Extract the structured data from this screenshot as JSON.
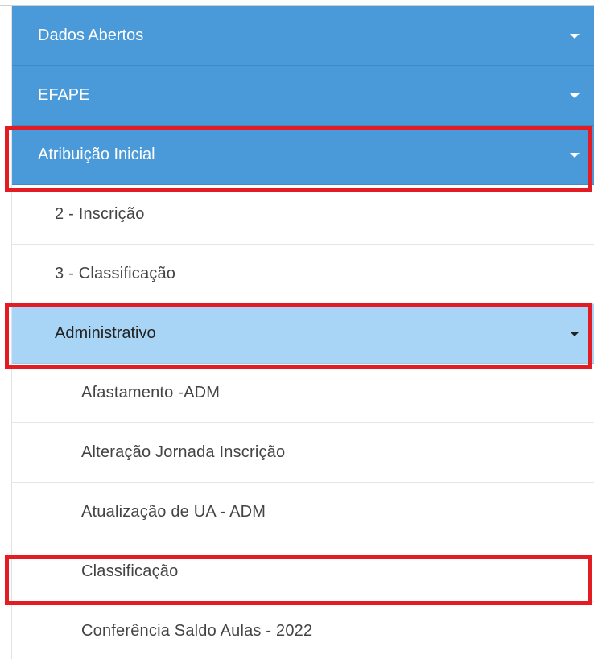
{
  "menu": {
    "dados_abertos": {
      "label": "Dados Abertos",
      "icon": "chevron-down-icon"
    },
    "efape": {
      "label": "EFAPE",
      "icon": "chevron-down-icon"
    },
    "atribuicao_inicial": {
      "label": "Atribuição Inicial",
      "icon": "chevron-down-icon",
      "children": {
        "inscricao": {
          "label": "2 - Inscrição"
        },
        "classificacao": {
          "label": "3 - Classificação"
        },
        "administrativo": {
          "label": "Administrativo",
          "icon": "chevron-down-icon",
          "children": {
            "afastamento": {
              "label": "Afastamento -ADM"
            },
            "alteracao_jornada": {
              "label": "Alteração Jornada Inscrição"
            },
            "atualizacao_ua": {
              "label": "Atualização de UA - ADM"
            },
            "classificacao": {
              "label": "Classificação"
            },
            "conferencia_saldo": {
              "label": "Conferência Saldo Aulas - 2022"
            }
          }
        }
      }
    }
  },
  "colors": {
    "primary": "#4a9ad9",
    "secondary": "#a8d4f5",
    "highlight": "#e31b23"
  }
}
